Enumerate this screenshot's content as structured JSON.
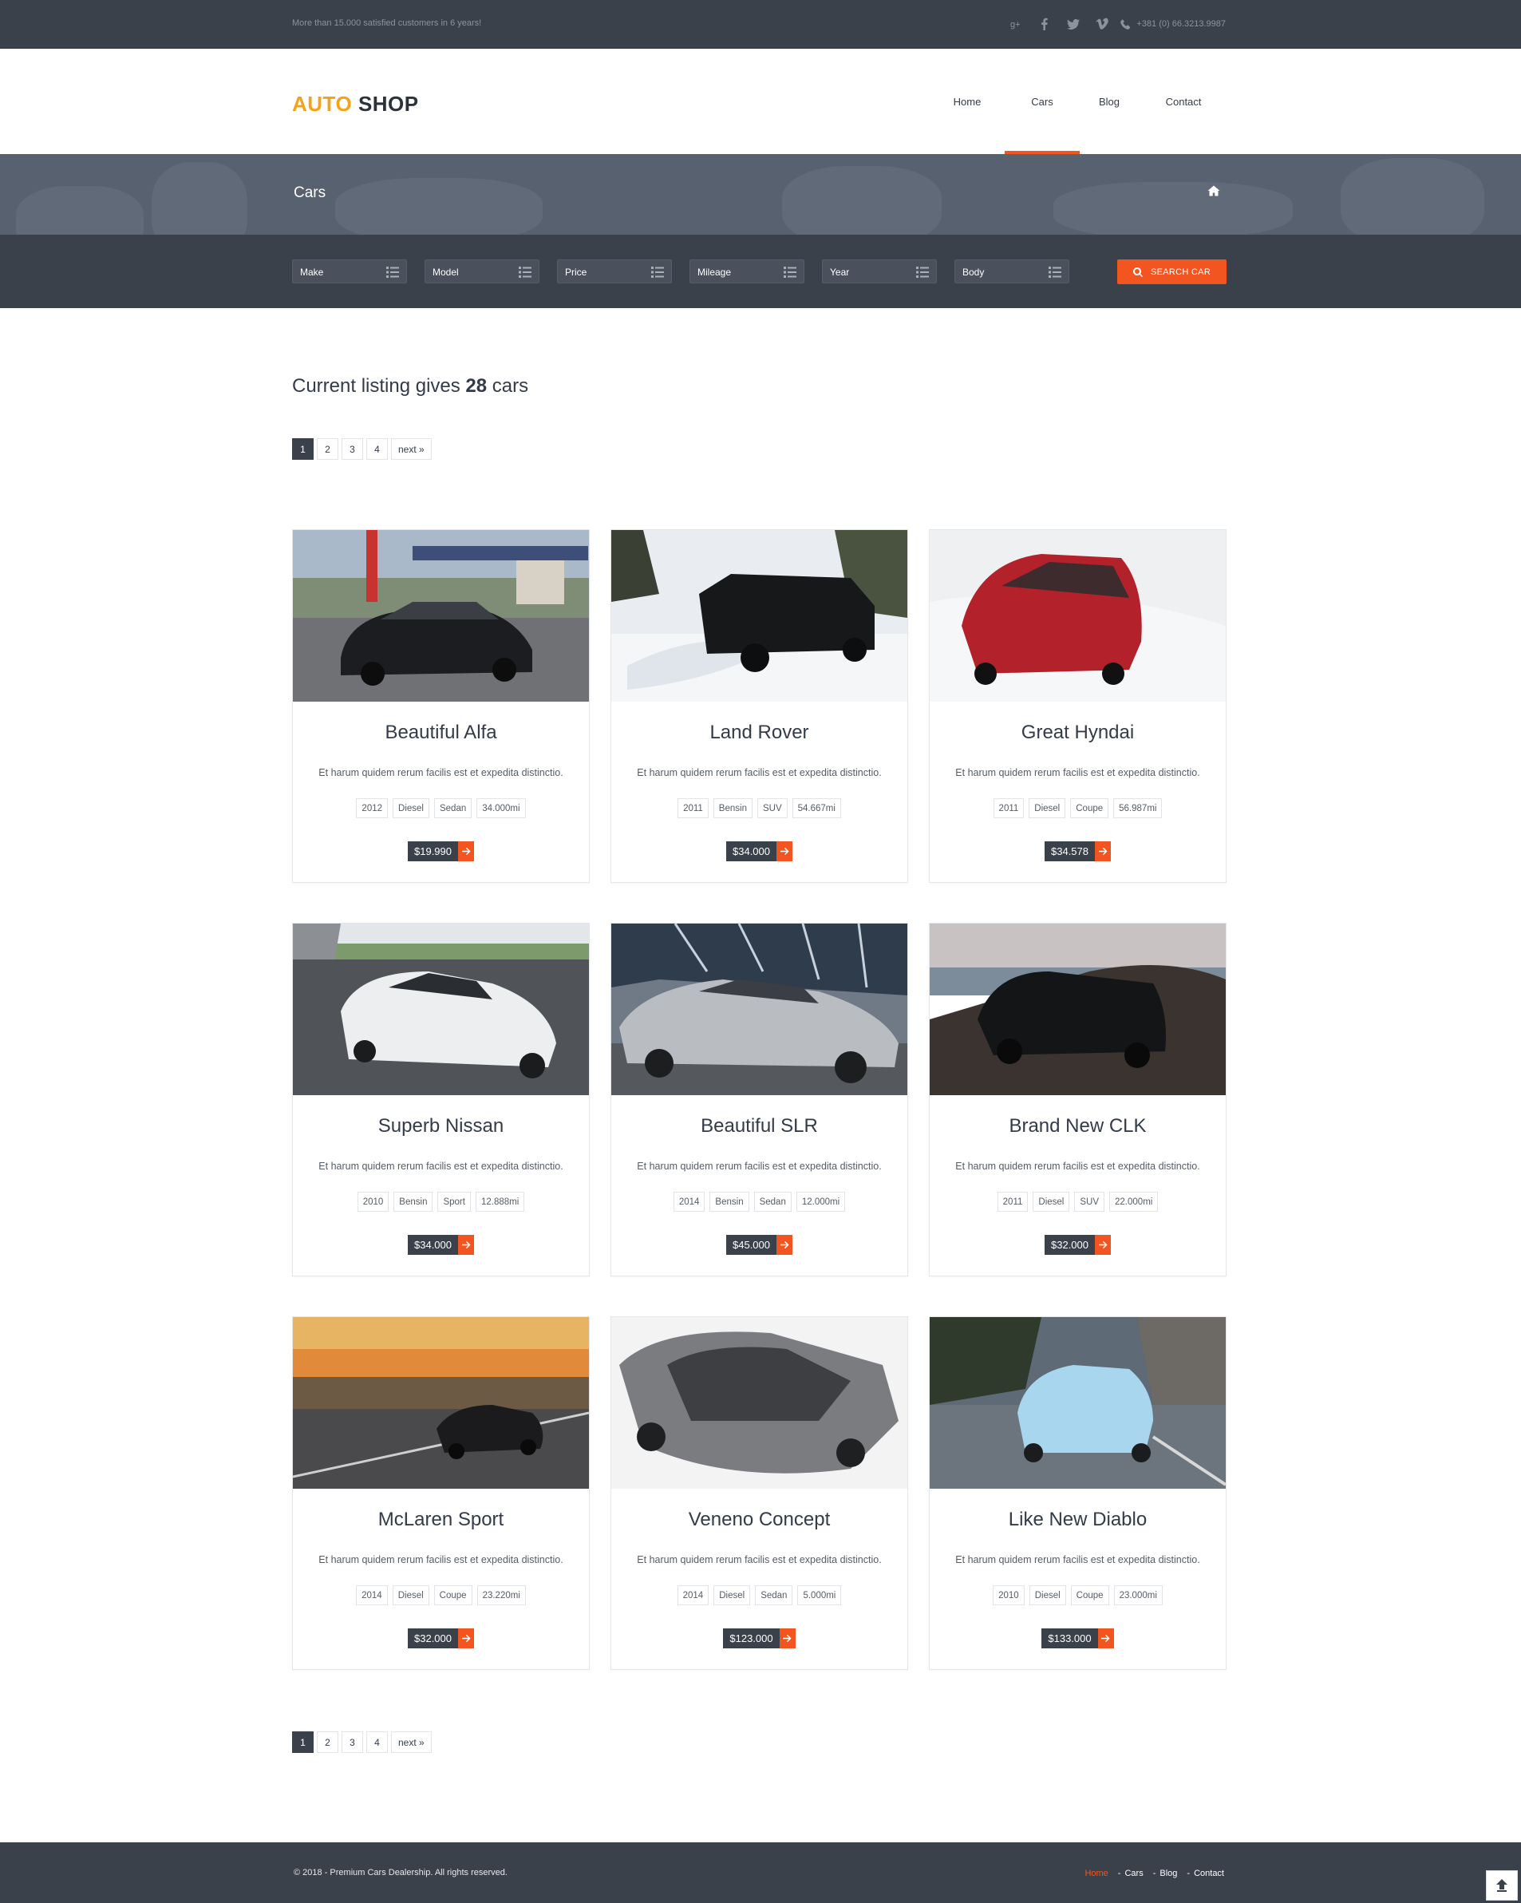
{
  "topbar": {
    "tagline": "More than 15.000 satisfied customers in 6 years!",
    "social_icons": [
      "google-plus-icon",
      "facebook-icon",
      "twitter-icon",
      "vimeo-icon"
    ],
    "phone": "+381 (0) 66.3213.9987"
  },
  "header": {
    "logo_part1": "AUTO",
    "logo_part2": "SHOP",
    "nav": [
      {
        "label": "Home"
      },
      {
        "label": "Cars",
        "active": true
      },
      {
        "label": "Blog"
      },
      {
        "label": "Contact"
      }
    ]
  },
  "page_title": "Cars",
  "filters": {
    "selects": [
      "Make",
      "Model",
      "Price",
      "Mileage",
      "Year",
      "Body"
    ],
    "search_label": "SEARCH CAR"
  },
  "listing": {
    "prefix": "Current listing gives",
    "count": "28",
    "suffix": "cars"
  },
  "pagination": {
    "pages": [
      "1",
      "2",
      "3",
      "4"
    ],
    "active_page": "1",
    "next_label": "next »"
  },
  "cars": [
    {
      "title": "Beautiful Alfa",
      "desc": "Et harum quidem rerum facilis est et expedita distinctio.",
      "tags": [
        "2012",
        "Diesel",
        "Sedan",
        "34.000mi"
      ],
      "price": "$19.990"
    },
    {
      "title": "Land Rover",
      "desc": "Et harum quidem rerum facilis est et expedita distinctio.",
      "tags": [
        "2011",
        "Bensin",
        "SUV",
        "54.667mi"
      ],
      "price": "$34.000"
    },
    {
      "title": "Great Hyndai",
      "desc": "Et harum quidem rerum facilis est et expedita distinctio.",
      "tags": [
        "2011",
        "Diesel",
        "Coupe",
        "56.987mi"
      ],
      "price": "$34.578"
    },
    {
      "title": "Superb Nissan",
      "desc": "Et harum quidem rerum facilis est et expedita distinctio.",
      "tags": [
        "2010",
        "Bensin",
        "Sport",
        "12.888mi"
      ],
      "price": "$34.000"
    },
    {
      "title": "Beautiful SLR",
      "desc": "Et harum quidem rerum facilis est et expedita distinctio.",
      "tags": [
        "2014",
        "Bensin",
        "Sedan",
        "12.000mi"
      ],
      "price": "$45.000"
    },
    {
      "title": "Brand New CLK",
      "desc": "Et harum quidem rerum facilis est et expedita distinctio.",
      "tags": [
        "2011",
        "Diesel",
        "SUV",
        "22.000mi"
      ],
      "price": "$32.000"
    },
    {
      "title": "McLaren Sport",
      "desc": "Et harum quidem rerum facilis est et expedita distinctio.",
      "tags": [
        "2014",
        "Diesel",
        "Coupe",
        "23.220mi"
      ],
      "price": "$32.000"
    },
    {
      "title": "Veneno Concept",
      "desc": "Et harum quidem rerum facilis est et expedita distinctio.",
      "tags": [
        "2014",
        "Diesel",
        "Sedan",
        "5.000mi"
      ],
      "price": "$123.000"
    },
    {
      "title": "Like New Diablo",
      "desc": "Et harum quidem rerum facilis est et expedita distinctio.",
      "tags": [
        "2010",
        "Diesel",
        "Coupe",
        "23.000mi"
      ],
      "price": "$133.000"
    }
  ],
  "footer": {
    "copyright": "© 2018 - Premium Cars Dealership. All rights reserved.",
    "links": [
      {
        "label": "Home",
        "active": true
      },
      {
        "label": "Cars"
      },
      {
        "label": "Blog"
      },
      {
        "label": "Contact"
      }
    ]
  },
  "colors": {
    "accent": "#f2551f",
    "logo_accent": "#f5a21b",
    "dark": "#3a414b"
  }
}
